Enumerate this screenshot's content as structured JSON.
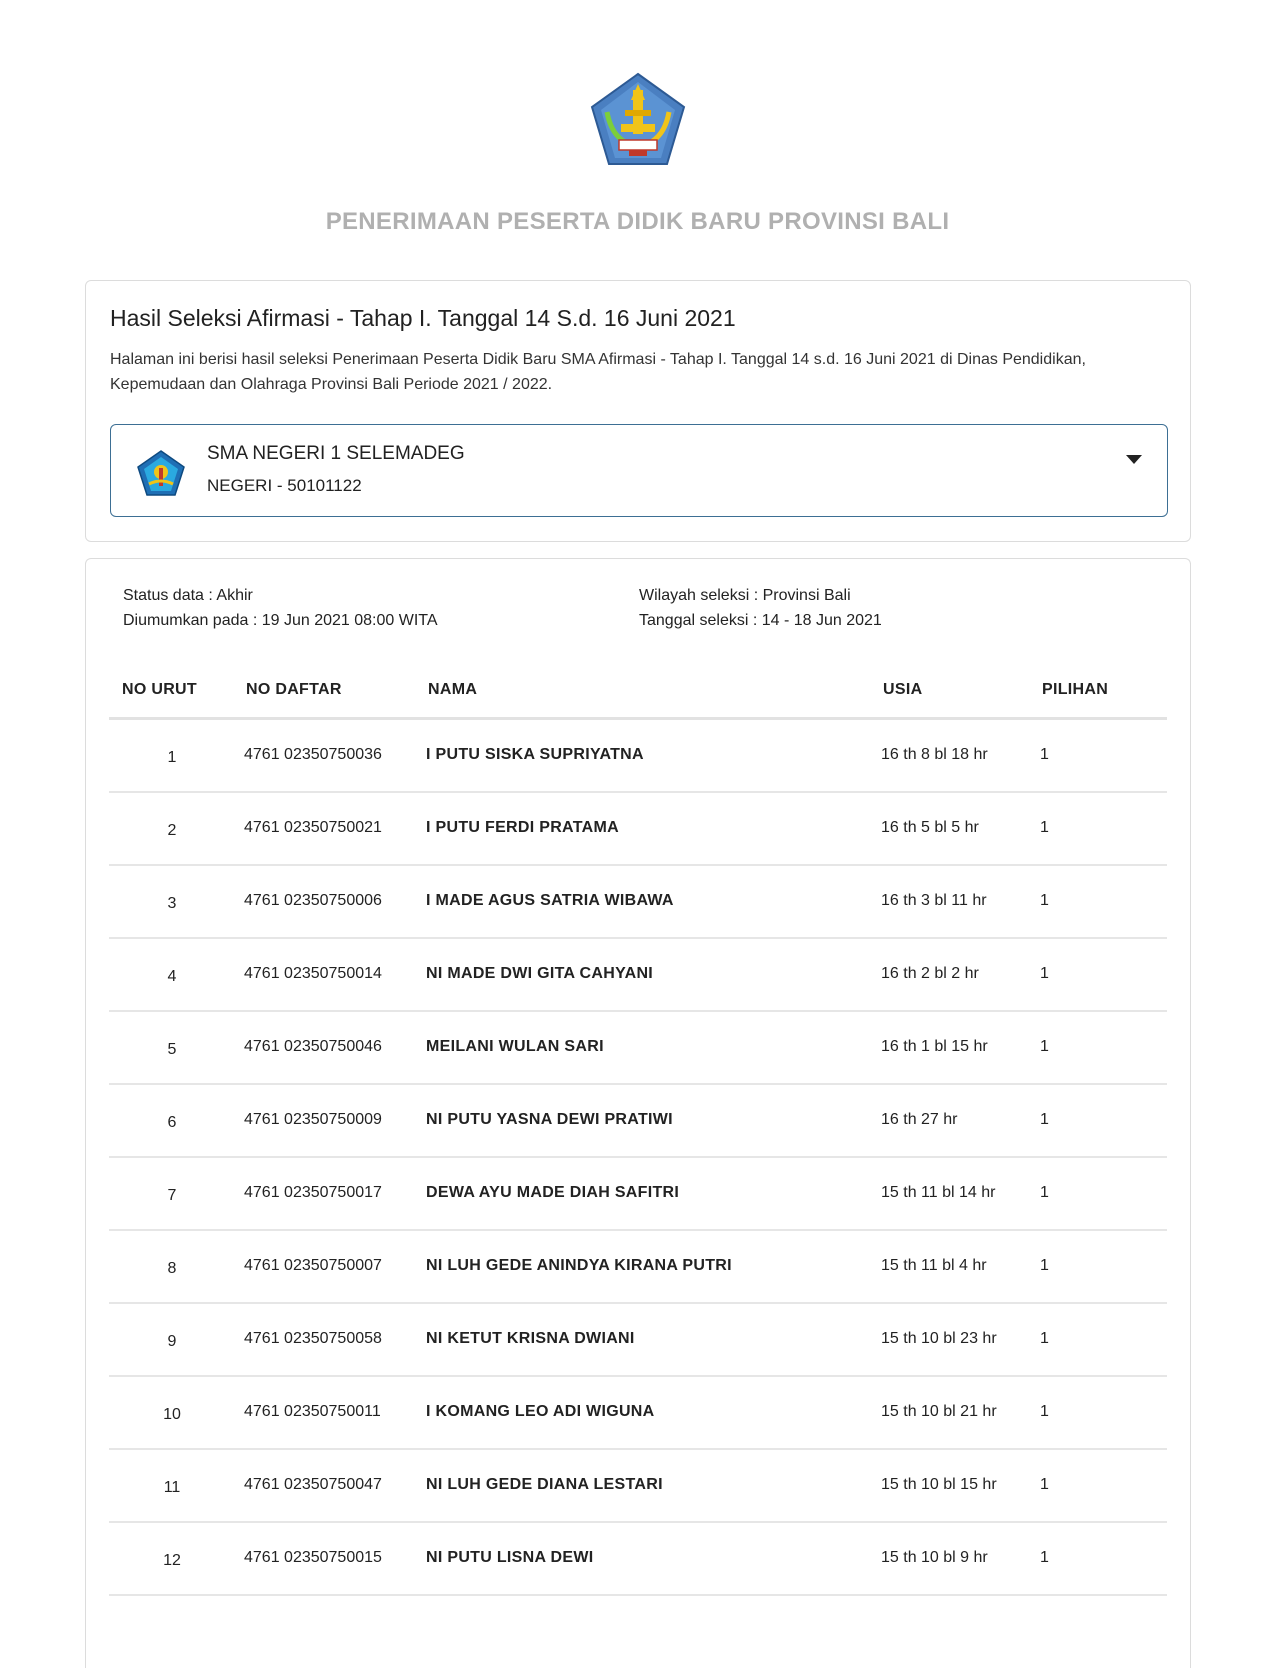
{
  "header": {
    "site_title": "PENERIMAAN PESERTA DIDIK BARU PROVINSI BALI",
    "logo_icon": "bali-province-crest-icon"
  },
  "info": {
    "title": "Hasil Seleksi Afirmasi - Tahap I. Tanggal 14 S.d. 16 Juni 2021",
    "description": "Halaman ini berisi hasil seleksi Penerimaan Peserta Didik Baru SMA Afirmasi - Tahap I. Tanggal 14 s.d. 16 Juni 2021 di Dinas Pendidikan, Kepemudaan dan Olahraga Provinsi Bali Periode 2021 / 2022."
  },
  "school_select": {
    "name": "SMA NEGERI 1 SELEMADEG",
    "subtitle": "NEGERI - 50101122",
    "logo_icon": "tut-wuri-handayani-icon",
    "toggle_icon": "caret-down-icon"
  },
  "meta": {
    "status": "Status data : Akhir",
    "announced": "Diumumkan pada : 19 Jun 2021 08:00 WITA",
    "region": "Wilayah seleksi : Provinsi Bali",
    "selection_date": "Tanggal seleksi : 14 - 18 Jun 2021"
  },
  "table": {
    "columns": [
      "NO URUT",
      "NO DAFTAR",
      "NAMA",
      "USIA",
      "PILIHAN"
    ],
    "rows": [
      {
        "no": "1",
        "daftar": "4761 02350750036",
        "nama": "I PUTU SISKA SUPRIYATNA",
        "usia": "16 th 8 bl 18 hr",
        "pilihan": "1"
      },
      {
        "no": "2",
        "daftar": "4761 02350750021",
        "nama": "I PUTU FERDI PRATAMA",
        "usia": "16 th 5 bl 5 hr",
        "pilihan": "1"
      },
      {
        "no": "3",
        "daftar": "4761 02350750006",
        "nama": "I MADE AGUS SATRIA WIBAWA",
        "usia": "16 th 3 bl 11 hr",
        "pilihan": "1"
      },
      {
        "no": "4",
        "daftar": "4761 02350750014",
        "nama": "NI MADE DWI GITA CAHYANI",
        "usia": "16 th 2 bl 2 hr",
        "pilihan": "1"
      },
      {
        "no": "5",
        "daftar": "4761 02350750046",
        "nama": "MEILANI WULAN SARI",
        "usia": "16 th 1 bl 15 hr",
        "pilihan": "1"
      },
      {
        "no": "6",
        "daftar": "4761 02350750009",
        "nama": "NI PUTU YASNA DEWI PRATIWI",
        "usia": "16 th 27 hr",
        "pilihan": "1"
      },
      {
        "no": "7",
        "daftar": "4761 02350750017",
        "nama": "DEWA AYU MADE DIAH SAFITRI",
        "usia": "15 th 11 bl 14 hr",
        "pilihan": "1"
      },
      {
        "no": "8",
        "daftar": "4761 02350750007",
        "nama": "NI LUH GEDE ANINDYA KIRANA PUTRI",
        "usia": "15 th 11 bl 4 hr",
        "pilihan": "1"
      },
      {
        "no": "9",
        "daftar": "4761 02350750058",
        "nama": "NI KETUT KRISNA DWIANI",
        "usia": "15 th 10 bl 23 hr",
        "pilihan": "1"
      },
      {
        "no": "10",
        "daftar": "4761 02350750011",
        "nama": "I KOMANG LEO ADI WIGUNA",
        "usia": "15 th 10 bl 21 hr",
        "pilihan": "1"
      },
      {
        "no": "11",
        "daftar": "4761 02350750047",
        "nama": "NI LUH GEDE DIANA LESTARI",
        "usia": "15 th 10 bl 15 hr",
        "pilihan": "1"
      },
      {
        "no": "12",
        "daftar": "4761 02350750015",
        "nama": "NI PUTU LISNA DEWI",
        "usia": "15 th 10 bl 9 hr",
        "pilihan": "1"
      }
    ]
  }
}
